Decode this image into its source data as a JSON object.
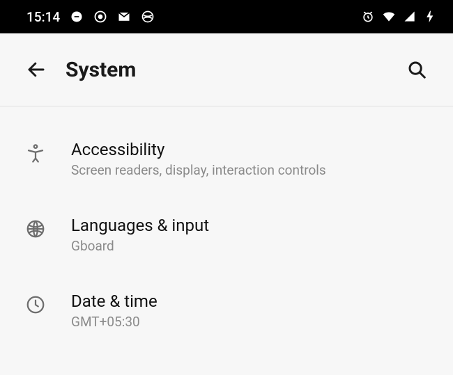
{
  "status": {
    "time": "15:14"
  },
  "header": {
    "title": "System"
  },
  "items": [
    {
      "title": "Accessibility",
      "subtitle": "Screen readers, display, interaction controls"
    },
    {
      "title": "Languages & input",
      "subtitle": "Gboard"
    },
    {
      "title": "Date & time",
      "subtitle": "GMT+05:30"
    }
  ]
}
